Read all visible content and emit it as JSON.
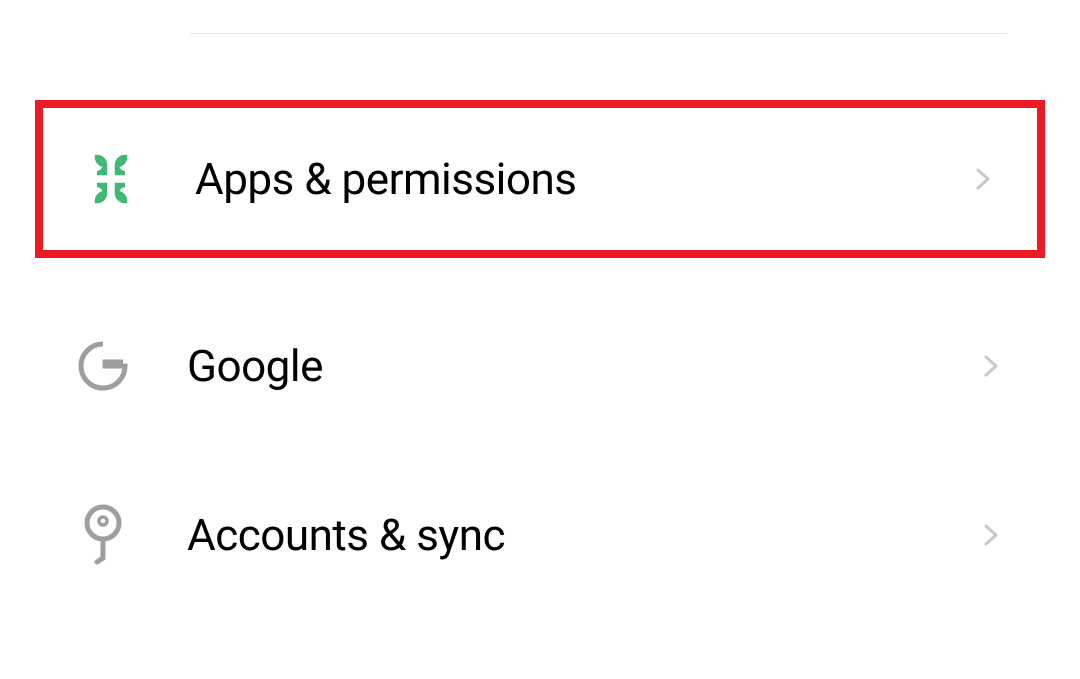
{
  "settings": {
    "items": [
      {
        "label": "Apps & permissions",
        "icon": "apps-icon",
        "highlighted": true
      },
      {
        "label": "Google",
        "icon": "google-icon",
        "highlighted": false
      },
      {
        "label": "Accounts & sync",
        "icon": "key-icon",
        "highlighted": false
      }
    ]
  },
  "colors": {
    "appsIcon": "#3fb876",
    "greyIcon": "#9e9e9e",
    "chevron": "#c7c7cc",
    "highlight": "#ed1c24"
  }
}
